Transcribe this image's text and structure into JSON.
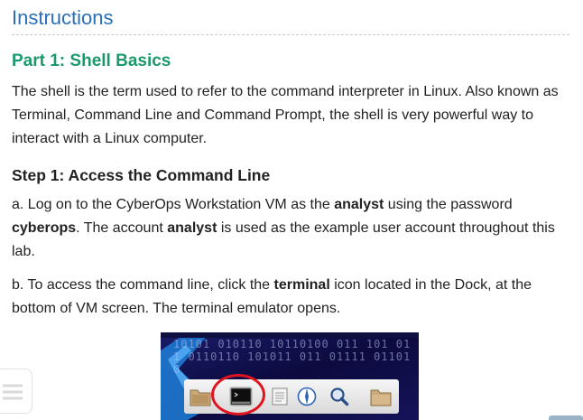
{
  "header": {
    "title": "Instructions"
  },
  "part": {
    "title": "Part 1: Shell Basics",
    "intro": "The shell is the term used to refer to the command interpreter in Linux. Also known as Terminal, Command Line and Command Prompt, the shell is very powerful way to interact with a Linux computer."
  },
  "step": {
    "title": "Step 1: Access the Command Line",
    "a": {
      "t1": "a. Log on to the CyberOps Workstation VM as the ",
      "b1": "analyst",
      "t2": " using the password ",
      "b2": "cyberops",
      "t3": ". The account ",
      "b3": "analyst",
      "t4": " is used as the example user account throughout this lab."
    },
    "b": {
      "t1": "b. To access the command line, click the ",
      "b1": "terminal",
      "t2": " icon located in the Dock, at the bottom of VM screen. The terminal emulator opens."
    }
  },
  "figure": {
    "binary_text": "10101 010110 10110100 011 101 011 0110110 101011 011 01111 011010",
    "dock_icons": [
      "file-manager-icon",
      "terminal-icon",
      "notes-icon",
      "browser-icon",
      "search-icon",
      "folder-icon"
    ],
    "highlight_color": "#e0141e"
  },
  "colors": {
    "heading_blue": "#2a6ebb",
    "part_green": "#1a9a6c",
    "body_text": "#222222"
  }
}
